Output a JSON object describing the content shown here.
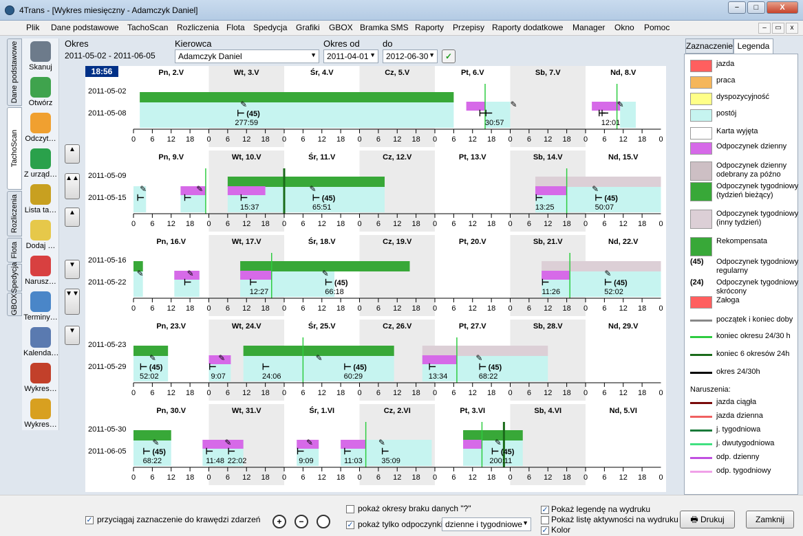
{
  "window": {
    "title": "4Trans - [Wykres miesięczny - Adamczyk Daniel]",
    "min": "−",
    "max": "□",
    "close": "X"
  },
  "menu": {
    "items": [
      "Plik",
      "Dane podstawowe",
      "TachoScan",
      "Rozliczenia",
      "Flota",
      "Spedycja",
      "Grafiki",
      "GBOX",
      "Bramka SMS",
      "Raporty",
      "Przepisy",
      "Raporty dodatkowe",
      "Manager",
      "Okno",
      "Pomoc"
    ],
    "mdi": [
      "–",
      "▭",
      "x"
    ]
  },
  "left_tabs": [
    "Dane podstawowe",
    "TachoScan",
    "Rozliczenia",
    "Flota",
    "Spedycja",
    "GBOX"
  ],
  "toolbar": [
    "Skanuj",
    "Otwórz",
    "Odczyt…",
    "Z urząd…",
    "Lista ta…",
    "Dodaj …",
    "Narusz…",
    "Terminy…",
    "Kalenda…",
    "Wykres…",
    "Wykres…"
  ],
  "filters": {
    "okres_label": "Okres",
    "okres_value": "2011-05-02 - 2011-06-05",
    "kierowca_label": "Kierowca",
    "kierowca_value": "Adamczyk Daniel",
    "okres_od_label": "Okres od",
    "okres_od_value": "2011-04-01",
    "do_label": "do",
    "do_value": "2012-06-30",
    "ok": "✓"
  },
  "clock": "18:56",
  "nav": [
    "▲",
    "▲▲",
    "▲",
    "▼",
    "▼▼",
    "▼"
  ],
  "hour_ticks": [
    "0",
    "6",
    "12",
    "18"
  ],
  "weeks": [
    {
      "range": [
        "2011-05-02",
        "2011-05-08"
      ],
      "days": [
        "Pn, 2.V",
        "Wt, 3.V",
        "Śr, 4.V",
        "Cz, 5.V",
        "Pt, 6.V",
        "Sb, 7.V",
        "Nd, 8.V"
      ],
      "bars": [
        {
          "s": 2,
          "e": 102,
          "t": "green"
        },
        {
          "s": 2,
          "e": 102,
          "t": "cyan"
        },
        {
          "s": 106,
          "e": 112,
          "t": "purple"
        },
        {
          "s": 112,
          "e": 120,
          "t": "cyan"
        },
        {
          "s": 146,
          "e": 155,
          "t": "purple"
        },
        {
          "s": 155,
          "e": 160,
          "t": "cyan"
        }
      ],
      "labels": [
        {
          "h": 36,
          "t": "(45)",
          "b": "277:59"
        },
        {
          "h": 115,
          "t": "",
          "b": "30:57"
        },
        {
          "h": 152,
          "t": "",
          "b": "12:01"
        }
      ],
      "vlines": [
        {
          "h": 112,
          "c": "#2ecc40"
        },
        {
          "h": 154,
          "c": "#2ecc40"
        }
      ],
      "beds": [
        {
          "h": 110
        },
        {
          "h": 148
        }
      ],
      "pencils": [
        {
          "h": 34
        },
        {
          "h": 120
        },
        {
          "h": 154
        }
      ]
    },
    {
      "range": [
        "2011-05-09",
        "2011-05-15"
      ],
      "days": [
        "Pn, 9.V",
        "Wt, 10.V",
        "Śr, 11.V",
        "Cz, 12.V",
        "Pt, 13.V",
        "Sb, 14.V",
        "Nd, 15.V"
      ],
      "bars": [
        {
          "s": 0,
          "e": 4,
          "t": "cyan"
        },
        {
          "s": 15,
          "e": 23,
          "t": "purple"
        },
        {
          "s": 15,
          "e": 23,
          "t": "cyan"
        },
        {
          "s": 30,
          "e": 80,
          "t": "green"
        },
        {
          "s": 30,
          "e": 42,
          "t": "purple"
        },
        {
          "s": 30,
          "e": 80,
          "t": "cyan"
        },
        {
          "s": 128,
          "e": 168,
          "t": "grey"
        },
        {
          "s": 128,
          "e": 138,
          "t": "purple"
        },
        {
          "s": 128,
          "e": 168,
          "t": "cyan"
        }
      ],
      "labels": [
        {
          "h": 37,
          "t": "",
          "b": "15:37"
        },
        {
          "h": 60,
          "t": "(45)",
          "b": "65:51"
        },
        {
          "h": 131,
          "t": "",
          "b": "13:25"
        },
        {
          "h": 150,
          "t": "(45)",
          "b": "50:07"
        }
      ],
      "vlines": [
        {
          "h": 23,
          "c": "#2ecc40"
        },
        {
          "h": 48,
          "c": "#1a6b1a"
        },
        {
          "h": 138,
          "c": "#2ecc40"
        }
      ],
      "beds": [
        {
          "h": 1
        },
        {
          "h": 16
        }
      ],
      "pencils": [
        {
          "h": 2
        },
        {
          "h": 20
        },
        {
          "h": 56
        },
        {
          "h": 146
        }
      ]
    },
    {
      "range": [
        "2011-05-16",
        "2011-05-22"
      ],
      "days": [
        "Pn, 16.V",
        "Wt, 17.V",
        "Śr, 18.V",
        "Cz, 19.V",
        "Pt, 20.V",
        "Sb, 21.V",
        "Nd, 22.V"
      ],
      "bars": [
        {
          "s": 0,
          "e": 3,
          "t": "green"
        },
        {
          "s": 0,
          "e": 3,
          "t": "cyan"
        },
        {
          "s": 13,
          "e": 21,
          "t": "purple"
        },
        {
          "s": 13,
          "e": 21,
          "t": "cyan"
        },
        {
          "s": 34,
          "e": 88,
          "t": "green"
        },
        {
          "s": 34,
          "e": 44,
          "t": "purple"
        },
        {
          "s": 34,
          "e": 64,
          "t": "cyan"
        },
        {
          "s": 130,
          "e": 168,
          "t": "grey"
        },
        {
          "s": 130,
          "e": 139,
          "t": "purple"
        },
        {
          "s": 130,
          "e": 168,
          "t": "cyan"
        }
      ],
      "labels": [
        {
          "h": 40,
          "t": "",
          "b": "12:27"
        },
        {
          "h": 64,
          "t": "(45)",
          "b": "66:18"
        },
        {
          "h": 133,
          "t": "",
          "b": "11:26"
        },
        {
          "h": 153,
          "t": "(45)",
          "b": "52:02"
        }
      ],
      "vlines": [
        {
          "h": 44,
          "c": "#2ecc40"
        },
        {
          "h": 139,
          "c": "#2ecc40"
        }
      ],
      "beds": [
        {
          "h": 16
        }
      ],
      "pencils": [
        {
          "h": 1
        },
        {
          "h": 17
        },
        {
          "h": 60
        },
        {
          "h": 150
        }
      ]
    },
    {
      "range": [
        "2011-05-23",
        "2011-05-29"
      ],
      "days": [
        "Pn, 23.V",
        "Wt, 24.V",
        "Śr, 25.V",
        "Cz, 26.V",
        "Pt, 27.V",
        "Sb, 28.V",
        "Nd, 29.V"
      ],
      "bars": [
        {
          "s": 0,
          "e": 11,
          "t": "green"
        },
        {
          "s": 0,
          "e": 11,
          "t": "cyan"
        },
        {
          "s": 24,
          "e": 31,
          "t": "purple"
        },
        {
          "s": 24,
          "e": 31,
          "t": "cyan"
        },
        {
          "s": 35,
          "e": 83,
          "t": "green"
        },
        {
          "s": 35,
          "e": 83,
          "t": "cyan"
        },
        {
          "s": 92,
          "e": 132,
          "t": "grey"
        },
        {
          "s": 92,
          "e": 103,
          "t": "purple"
        },
        {
          "s": 92,
          "e": 132,
          "t": "cyan"
        }
      ],
      "labels": [
        {
          "h": 5,
          "t": "(45)",
          "b": "52:02"
        },
        {
          "h": 27,
          "t": "",
          "b": "9:07"
        },
        {
          "h": 44,
          "t": "",
          "b": "24:06"
        },
        {
          "h": 70,
          "t": "(45)",
          "b": "60:29"
        },
        {
          "h": 97,
          "t": "",
          "b": "13:34"
        },
        {
          "h": 113,
          "t": "(45)",
          "b": "68:22"
        }
      ],
      "vlines": [
        {
          "h": 54,
          "c": "#2ecc40"
        },
        {
          "h": 103,
          "c": "#2ecc40"
        }
      ],
      "beds": [],
      "pencils": [
        {
          "h": 5
        },
        {
          "h": 27
        },
        {
          "h": 58
        },
        {
          "h": 109
        }
      ]
    },
    {
      "range": [
        "2011-05-30",
        "2011-06-05"
      ],
      "days": [
        "Pn, 30.V",
        "Wt, 31.V",
        "Śr, 1.VI",
        "Cz, 2.VI",
        "Pt, 3.VI",
        "Sb, 4.VI",
        "Nd, 5.VI"
      ],
      "bars": [
        {
          "s": 0,
          "e": 12,
          "t": "green"
        },
        {
          "s": 0,
          "e": 12,
          "t": "cyan"
        },
        {
          "s": 22,
          "e": 35,
          "t": "purple"
        },
        {
          "s": 22,
          "e": 35,
          "t": "cyan"
        },
        {
          "s": 52,
          "e": 59,
          "t": "purple"
        },
        {
          "s": 52,
          "e": 59,
          "t": "cyan"
        },
        {
          "s": 66,
          "e": 74,
          "t": "purple"
        },
        {
          "s": 66,
          "e": 95,
          "t": "cyan"
        },
        {
          "s": 105,
          "e": 124,
          "t": "green"
        },
        {
          "s": 105,
          "e": 111,
          "t": "purple"
        },
        {
          "s": 105,
          "e": 124,
          "t": "cyan"
        }
      ],
      "labels": [
        {
          "h": 6,
          "t": "(45)",
          "b": "68:22"
        },
        {
          "h": 26,
          "t": "",
          "b": "11:48"
        },
        {
          "h": 33,
          "t": "",
          "b": "22:02"
        },
        {
          "h": 55,
          "t": "",
          "b": "9:09"
        },
        {
          "h": 70,
          "t": "",
          "b": "11:03"
        },
        {
          "h": 82,
          "t": "",
          "b": "35:09"
        },
        {
          "h": 117,
          "t": "(45)",
          "b": "200:11"
        }
      ],
      "vlines": [
        {
          "h": 74,
          "c": "#2ecc40"
        },
        {
          "h": 111,
          "c": "#2ecc40"
        },
        {
          "h": 118,
          "c": "#1a6b1a"
        }
      ],
      "beds": [],
      "pencils": [
        {
          "h": 6
        },
        {
          "h": 29
        },
        {
          "h": 55
        },
        {
          "h": 78
        },
        {
          "h": 115
        }
      ]
    }
  ],
  "right_tabs": [
    "Zaznaczenie",
    "Legenda"
  ],
  "legend": [
    {
      "label": "jazda",
      "color": "#ff5f5f"
    },
    {
      "label": "praca",
      "color": "#f5b65a"
    },
    {
      "label": "dyspozycyjność",
      "color": "#ffff88"
    },
    {
      "label": "postój",
      "color": "#c6f4f0"
    },
    {
      "label": "Karta wyjęta",
      "color": "#ffffff"
    },
    {
      "label": "Odpoczynek dzienny",
      "color": "#d66ae8"
    },
    {
      "label": "Odpoczynek dzienny odebrany za późno",
      "color": "#cdbfc4"
    },
    {
      "label": "Odpoczynek tygodniowy (tydzień bieżący)",
      "color": "#38a838"
    },
    {
      "label": "Odpoczynek tygodniowy (inny tydzień)",
      "color": "#dccfd6"
    },
    {
      "label": "Rekompensata",
      "color": "#38a838"
    },
    {
      "label": "Odpoczynek tygodniowy regularny",
      "color": "",
      "icon": "(45)"
    },
    {
      "label": "Odpoczynek tygodniowy skrócony",
      "color": "",
      "icon": "(24)"
    },
    {
      "label": "Załoga",
      "color": "#ff5f5f"
    },
    {
      "label": "początek i koniec doby",
      "color": "#888888"
    },
    {
      "label": "koniec okresu 24/30 h",
      "color": "#2ecc40"
    },
    {
      "label": "koniec 6 okresów 24h",
      "color": "#1a6b1a"
    },
    {
      "label": "okres 24/30h",
      "color": "#000000"
    },
    {
      "label": "Naruszenia:",
      "color": ""
    },
    {
      "label": "jazda ciągła",
      "color": "#7a0a0a"
    },
    {
      "label": "jazda dzienna",
      "color": "#f06060"
    },
    {
      "label": "j. tygodniowa",
      "color": "#1a7a3a"
    },
    {
      "label": "j. dwutygodniowa",
      "color": "#40e080"
    },
    {
      "label": "odp. dzienny",
      "color": "#c050e0"
    },
    {
      "label": "odp. tygodniowy",
      "color": "#f0a0e8"
    }
  ],
  "bottom": {
    "snap": "przyciągaj zaznaczenie do krawędzi zdarzeń",
    "missing": "pokaż okresy braku danych \"?\"",
    "only_rest": "pokaż tylko odpoczynki",
    "rest_type": "dzienne i tygodniowe",
    "legend_print": "Pokaż legendę na wydruku",
    "activity_print": "Pokaż listę aktywności na wydruku",
    "color": "Kolor",
    "print": "Drukuj",
    "close": "Zamknij"
  }
}
